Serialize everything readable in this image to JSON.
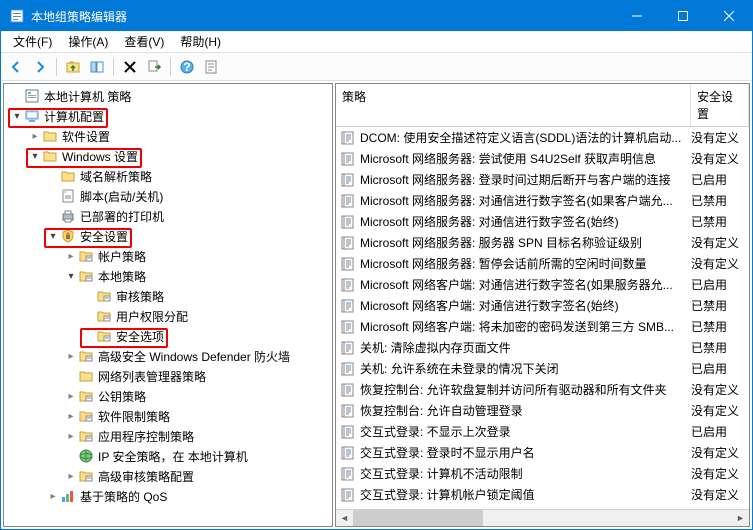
{
  "title": "本地组策略编辑器",
  "menu": {
    "file": "文件(F)",
    "action": "操作(A)",
    "view": "查看(V)",
    "help": "帮助(H)"
  },
  "columns": {
    "policy": "策略",
    "setting": "安全设置"
  },
  "tree": [
    {
      "indent": 0,
      "twisty": "none",
      "icon": "console",
      "label": "本地计算机 策略"
    },
    {
      "indent": 0,
      "twisty": "open",
      "icon": "computer",
      "label": "计算机配置",
      "hl": true
    },
    {
      "indent": 1,
      "twisty": "closed",
      "icon": "folder",
      "label": "软件设置"
    },
    {
      "indent": 1,
      "twisty": "open",
      "icon": "folder",
      "label": "Windows 设置",
      "hl": true
    },
    {
      "indent": 2,
      "twisty": "none",
      "icon": "folder",
      "label": "域名解析策略"
    },
    {
      "indent": 2,
      "twisty": "none",
      "icon": "script",
      "label": "脚本(启动/关机)"
    },
    {
      "indent": 2,
      "twisty": "none",
      "icon": "printer",
      "label": "已部署的打印机"
    },
    {
      "indent": 2,
      "twisty": "open",
      "icon": "security",
      "label": "安全设置",
      "hl": true
    },
    {
      "indent": 3,
      "twisty": "closed",
      "icon": "folder-b",
      "label": "帐户策略"
    },
    {
      "indent": 3,
      "twisty": "open",
      "icon": "folder-b",
      "label": "本地策略"
    },
    {
      "indent": 4,
      "twisty": "none",
      "icon": "folder-b",
      "label": "审核策略"
    },
    {
      "indent": 4,
      "twisty": "none",
      "icon": "folder-b",
      "label": "用户权限分配"
    },
    {
      "indent": 4,
      "twisty": "none",
      "icon": "folder-b",
      "label": "安全选项",
      "hl": true
    },
    {
      "indent": 3,
      "twisty": "closed",
      "icon": "folder-b",
      "label": "高级安全 Windows Defender 防火墙"
    },
    {
      "indent": 3,
      "twisty": "none",
      "icon": "folder",
      "label": "网络列表管理器策略"
    },
    {
      "indent": 3,
      "twisty": "closed",
      "icon": "folder-b",
      "label": "公钥策略"
    },
    {
      "indent": 3,
      "twisty": "closed",
      "icon": "folder-b",
      "label": "软件限制策略"
    },
    {
      "indent": 3,
      "twisty": "closed",
      "icon": "folder-b",
      "label": "应用程序控制策略"
    },
    {
      "indent": 3,
      "twisty": "none",
      "icon": "ipsec",
      "label": "IP 安全策略，在 本地计算机"
    },
    {
      "indent": 3,
      "twisty": "closed",
      "icon": "folder-b",
      "label": "高级审核策略配置"
    },
    {
      "indent": 2,
      "twisty": "closed",
      "icon": "qos",
      "label": "基于策略的 QoS"
    }
  ],
  "list": [
    {
      "policy": "DCOM: 使用安全描述符定义语言(SDDL)语法的计算机启动...",
      "setting": "没有定义"
    },
    {
      "policy": "Microsoft 网络服务器: 尝试使用 S4U2Self 获取声明信息",
      "setting": "没有定义"
    },
    {
      "policy": "Microsoft 网络服务器: 登录时间过期后断开与客户端的连接",
      "setting": "已启用"
    },
    {
      "policy": "Microsoft 网络服务器: 对通信进行数字签名(如果客户端允...",
      "setting": "已禁用"
    },
    {
      "policy": "Microsoft 网络服务器: 对通信进行数字签名(始终)",
      "setting": "已禁用"
    },
    {
      "policy": "Microsoft 网络服务器: 服务器 SPN 目标名称验证级别",
      "setting": "没有定义"
    },
    {
      "policy": "Microsoft 网络服务器: 暂停会话前所需的空闲时间数量",
      "setting": "没有定义"
    },
    {
      "policy": "Microsoft 网络客户端: 对通信进行数字签名(如果服务器允...",
      "setting": "已启用"
    },
    {
      "policy": "Microsoft 网络客户端: 对通信进行数字签名(始终)",
      "setting": "已禁用"
    },
    {
      "policy": "Microsoft 网络客户端: 将未加密的密码发送到第三方 SMB...",
      "setting": "已禁用"
    },
    {
      "policy": "关机: 清除虚拟内存页面文件",
      "setting": "已禁用"
    },
    {
      "policy": "关机: 允许系统在未登录的情况下关闭",
      "setting": "已启用"
    },
    {
      "policy": "恢复控制台: 允许软盘复制并访问所有驱动器和所有文件夹",
      "setting": "没有定义"
    },
    {
      "policy": "恢复控制台: 允许自动管理登录",
      "setting": "没有定义"
    },
    {
      "policy": "交互式登录: 不显示上次登录",
      "setting": "已启用"
    },
    {
      "policy": "交互式登录: 登录时不显示用户名",
      "setting": "没有定义"
    },
    {
      "policy": "交互式登录: 计算机不活动限制",
      "setting": "没有定义"
    },
    {
      "policy": "交互式登录: 计算机帐户锁定阈值",
      "setting": "没有定义"
    }
  ]
}
